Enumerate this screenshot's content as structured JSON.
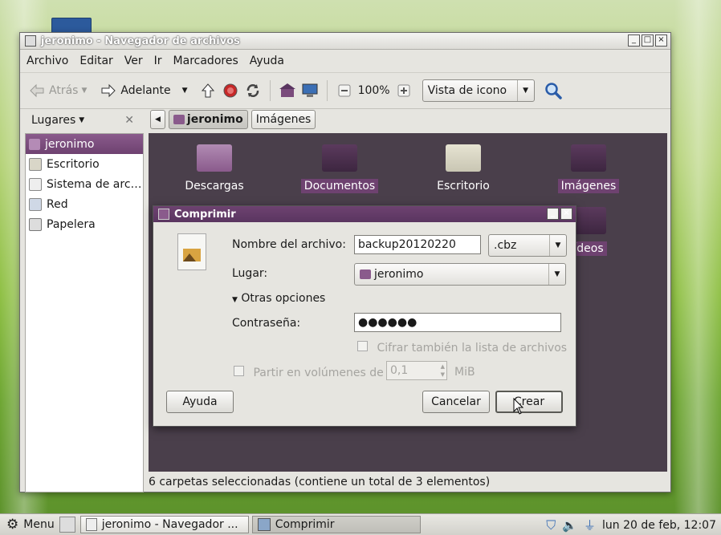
{
  "window": {
    "title": "jeronimo - Navegador de archivos",
    "controls": [
      "_",
      "□",
      "×"
    ]
  },
  "menubar": [
    "Archivo",
    "Editar",
    "Ver",
    "Ir",
    "Marcadores",
    "Ayuda"
  ],
  "toolbar": {
    "back": "Atrás",
    "forward": "Adelante",
    "zoom": "100%",
    "view": "Vista de icono"
  },
  "sidebar": {
    "header": "Lugares",
    "items": [
      {
        "label": "jeronimo",
        "icon": "home-icon"
      },
      {
        "label": "Escritorio",
        "icon": "desktop-icon"
      },
      {
        "label": "Sistema de arc…",
        "icon": "drive-icon"
      },
      {
        "label": "Red",
        "icon": "network-icon"
      },
      {
        "label": "Papelera",
        "icon": "trash-icon"
      }
    ]
  },
  "pathbar": {
    "crumbs": [
      "jeronimo",
      "Imágenes"
    ]
  },
  "folders": [
    {
      "label": "Descargas",
      "selected": false
    },
    {
      "label": "Documentos",
      "selected": true
    },
    {
      "label": "Escritorio",
      "selected": false
    },
    {
      "label": "Imágenes",
      "selected": true
    },
    {
      "label": "ídeos",
      "selected": true
    }
  ],
  "status": "6 carpetas seleccionadas (contiene un total de 3 elementos)",
  "dialog": {
    "title": "Comprimir",
    "filename_label": "Nombre del archivo:",
    "filename_value": "backup20120220",
    "extension": ".cbz",
    "location_label": "Lugar:",
    "location_value": "jeronimo",
    "more_options": "Otras opciones",
    "password_label": "Contraseña:",
    "password_value": "●●●●●●",
    "encrypt_label": "Cifrar también la lista de archivos",
    "split_label": "Partir en volúmenes de",
    "split_value": "0,1",
    "split_unit": "MiB",
    "help": "Ayuda",
    "cancel": "Cancelar",
    "create": "Crear"
  },
  "panel": {
    "menu": "Menu",
    "tasks": [
      "jeronimo - Navegador ...",
      "Comprimir"
    ],
    "clock": "lun 20 de feb, 12:07"
  },
  "colors": {
    "accent": "#6e4270",
    "content_bg": "#4a3f4b",
    "window_bg": "#e6e5e0"
  }
}
